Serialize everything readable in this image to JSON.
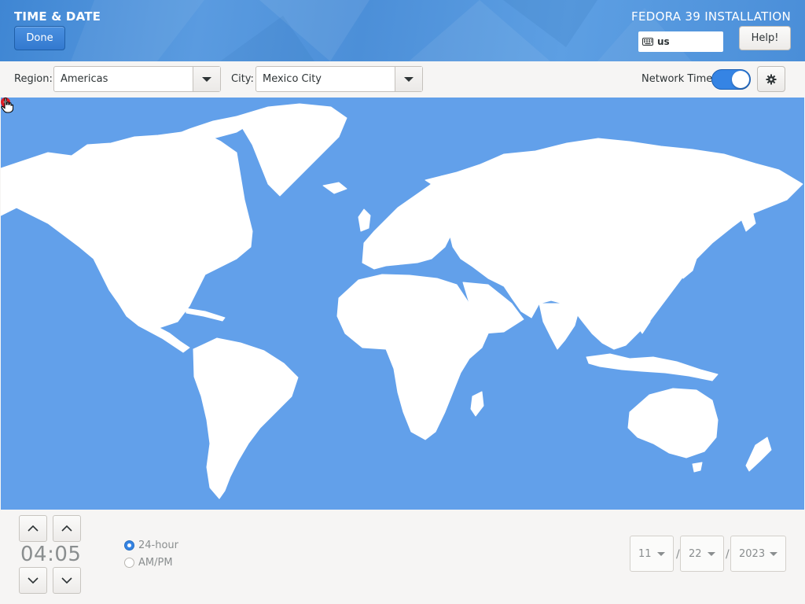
{
  "header": {
    "title": "TIME & DATE",
    "done_label": "Done",
    "install_title": "FEDORA 39 INSTALLATION",
    "keyboard_layout": "us",
    "help_label": "Help!"
  },
  "toolbar": {
    "region_label": "Region:",
    "region_value": "Americas",
    "city_label": "City:",
    "city_value": "Mexico City",
    "network_time_label": "Network Time",
    "network_time_enabled": true
  },
  "map": {
    "selected_city": "Mexico City"
  },
  "time": {
    "hours": "04",
    "separator": ":",
    "minutes": "05",
    "format_24h_label": "24-hour",
    "format_ampm_label": "AM/PM",
    "selected_format": "24-hour"
  },
  "date": {
    "month": "11",
    "day": "22",
    "year": "2023",
    "separator": "/"
  },
  "colors": {
    "accent": "#3584e4",
    "map_ocean": "#62a0ea",
    "header_blue": "#4a8ed8"
  }
}
